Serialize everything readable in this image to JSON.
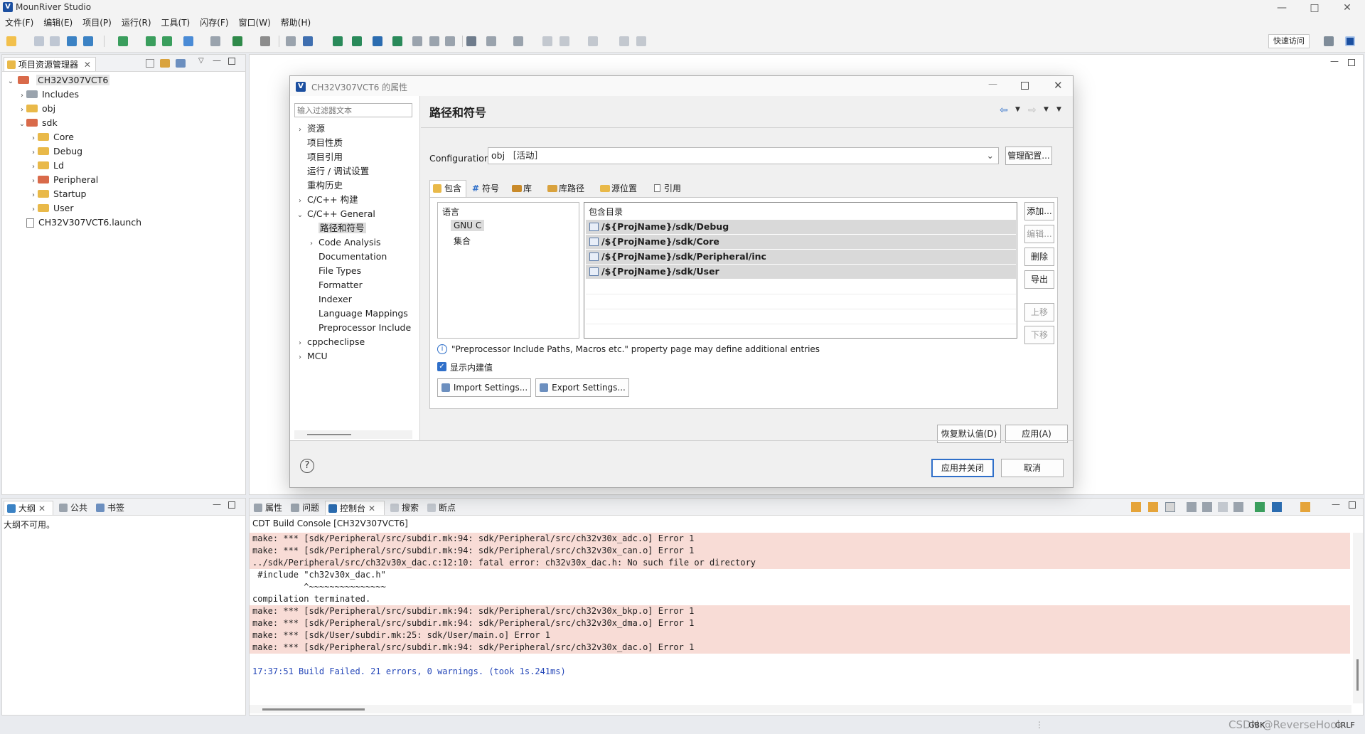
{
  "window": {
    "title": "MounRiver Studio",
    "controls": {
      "minimize": "—",
      "maximize": "□",
      "close": "✕"
    }
  },
  "menu": [
    "文件(F)",
    "编辑(E)",
    "项目(P)",
    "运行(R)",
    "工具(T)",
    "闪存(F)",
    "窗口(W)",
    "帮助(H)"
  ],
  "toolbar": {
    "quick_access": "快速访问"
  },
  "project_explorer": {
    "tab": "项目资源管理器",
    "project": "CH32V307VCT6",
    "items": [
      {
        "label": "Includes",
        "depth": 1
      },
      {
        "label": "obj",
        "depth": 1
      },
      {
        "label": "sdk",
        "depth": 1
      },
      {
        "label": "Core",
        "depth": 2
      },
      {
        "label": "Debug",
        "depth": 2
      },
      {
        "label": "Ld",
        "depth": 2
      },
      {
        "label": "Peripheral",
        "depth": 2
      },
      {
        "label": "Startup",
        "depth": 2
      },
      {
        "label": "User",
        "depth": 2
      },
      {
        "label": "CH32V307VCT6.launch",
        "depth": 1
      }
    ]
  },
  "outline": {
    "tabs": [
      "大纲",
      "公共",
      "书签"
    ],
    "empty_text": "大纲不可用。"
  },
  "dialog": {
    "title": "CH32V307VCT6 的属性",
    "filter_placeholder": "输入过滤器文本",
    "nav": [
      {
        "label": "资源",
        "expandable": true,
        "depth": 0
      },
      {
        "label": "项目性质",
        "expandable": false,
        "depth": 0
      },
      {
        "label": "项目引用",
        "expandable": false,
        "depth": 0
      },
      {
        "label": "运行 / 调试设置",
        "expandable": false,
        "depth": 0
      },
      {
        "label": "重构历史",
        "expandable": false,
        "depth": 0
      },
      {
        "label": "C/C++ 构建",
        "expandable": true,
        "depth": 0
      },
      {
        "label": "C/C++ General",
        "expandable": true,
        "depth": 0
      },
      {
        "label": "路径和符号",
        "expandable": false,
        "depth": 1
      },
      {
        "label": "Code Analysis",
        "expandable": true,
        "depth": 1
      },
      {
        "label": "Documentation",
        "expandable": false,
        "depth": 1
      },
      {
        "label": "File Types",
        "expandable": false,
        "depth": 1
      },
      {
        "label": "Formatter",
        "expandable": false,
        "depth": 1
      },
      {
        "label": "Indexer",
        "expandable": false,
        "depth": 1
      },
      {
        "label": "Language Mappings",
        "expandable": false,
        "depth": 1
      },
      {
        "label": "Preprocessor Include",
        "expandable": false,
        "depth": 1
      },
      {
        "label": "cppcheclipse",
        "expandable": true,
        "depth": 0
      },
      {
        "label": "MCU",
        "expandable": true,
        "depth": 0
      }
    ],
    "page_title": "路径和符号",
    "config_label": "Configuration:",
    "config_value": "obj ［活动］",
    "manage_button": "管理配置...",
    "tabs": [
      "包含",
      "符号",
      "库",
      "库路径",
      "源位置",
      "引用"
    ],
    "lang_header": "语言",
    "languages": [
      "GNU C",
      "集合"
    ],
    "include_header": "包含目录",
    "includes": [
      "/${ProjName}/sdk/Debug",
      "/${ProjName}/sdk/Core",
      "/${ProjName}/sdk/Peripheral/inc",
      "/${ProjName}/sdk/User"
    ],
    "side_buttons": [
      "添加...",
      "编辑...",
      "删除",
      "导出",
      "上移",
      "下移"
    ],
    "info_text": "\"Preprocessor Include Paths, Macros etc.\" property page may define additional entries",
    "show_builtin": "显示内建值",
    "import_button": "Import Settings...",
    "export_button": "Export Settings...",
    "restore_button": "恢复默认值(D)",
    "apply_button": "应用(A)",
    "apply_close_button": "应用并关闭",
    "cancel_button": "取消",
    "help_glyph": "?"
  },
  "console": {
    "tabs": [
      "属性",
      "问题",
      "控制台",
      "搜索",
      "断点"
    ],
    "title": "CDT Build Console [CH32V307VCT6]",
    "lines": [
      {
        "text": "make: *** [sdk/Peripheral/src/subdir.mk:94: sdk/Peripheral/src/ch32v30x_adc.o] Error 1",
        "kind": "err"
      },
      {
        "text": "make: *** [sdk/Peripheral/src/subdir.mk:94: sdk/Peripheral/src/ch32v30x_can.o] Error 1",
        "kind": "err"
      },
      {
        "text": "../sdk/Peripheral/src/ch32v30x_dac.c:12:10: fatal error: ch32v30x_dac.h: No such file or directory",
        "kind": "err"
      },
      {
        "text": " #include \"ch32v30x_dac.h\"",
        "kind": "plain"
      },
      {
        "text": "          ^~~~~~~~~~~~~~~~",
        "kind": "plain"
      },
      {
        "text": "compilation terminated.",
        "kind": "plain"
      },
      {
        "text": "make: *** [sdk/Peripheral/src/subdir.mk:94: sdk/Peripheral/src/ch32v30x_bkp.o] Error 1",
        "kind": "err"
      },
      {
        "text": "make: *** [sdk/Peripheral/src/subdir.mk:94: sdk/Peripheral/src/ch32v30x_dma.o] Error 1",
        "kind": "err"
      },
      {
        "text": "make: *** [sdk/User/subdir.mk:25: sdk/User/main.o] Error 1",
        "kind": "err"
      },
      {
        "text": "make: *** [sdk/Peripheral/src/subdir.mk:94: sdk/Peripheral/src/ch32v30x_dac.o] Error 1",
        "kind": "err"
      },
      {
        "text": "",
        "kind": "plain"
      },
      {
        "text": "17:37:51 Build Failed. 21 errors, 0 warnings. (took 1s.241ms)",
        "kind": "ok"
      }
    ]
  },
  "statusbar": {
    "encoding": "GBK",
    "line_ending": "CRLF",
    "watermark": "CSDN @ReverseHook"
  },
  "colors": {
    "accent": "#2f6fc9",
    "error_bg": "#f8dcd6",
    "build_status": "#2547b8"
  }
}
